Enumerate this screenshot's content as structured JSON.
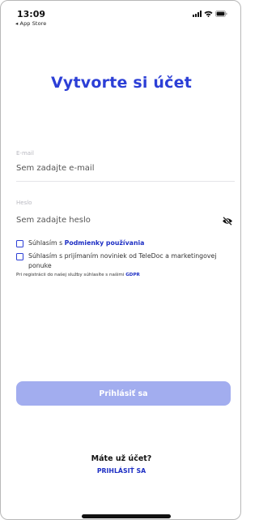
{
  "status_bar": {
    "time": "13:09",
    "back_app": "◂ App Store"
  },
  "title": "Vytvorte si účet",
  "email": {
    "label": "E-mail",
    "placeholder": "Sem zadajte e-mail",
    "value": ""
  },
  "password": {
    "label": "Heslo",
    "placeholder": "Sem zadajte heslo",
    "value": "",
    "toggle_icon": "eye-slash-icon"
  },
  "terms": {
    "prefix": "Súhlasím s ",
    "link": "Podmienky používania",
    "checked": false
  },
  "newsletter": {
    "text": "Súhlasím s prijímaním noviniek od TeleDoc a marketingovej ponuke",
    "checked": false
  },
  "gdpr": {
    "prefix": "Pri registrácii do našej služby súhlasíte s našimi ",
    "link": "GDPR"
  },
  "submit_label": "Prihlásiť sa",
  "footer": {
    "have_account": "Máte už účet?",
    "login_link": "PRIHLÁSIŤ SA"
  },
  "colors": {
    "accent": "#2c3fd6",
    "button_disabled": "#a2adef"
  }
}
